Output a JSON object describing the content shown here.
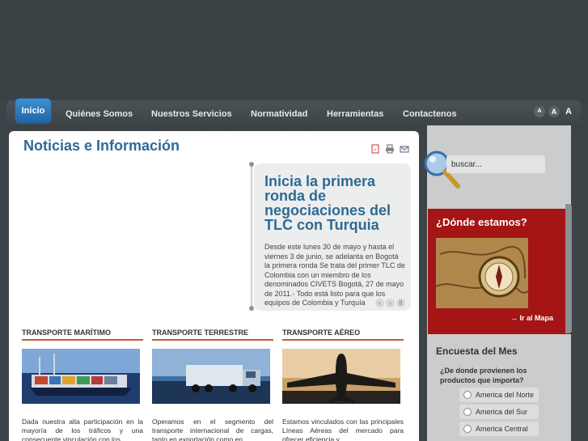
{
  "nav": {
    "items": [
      "Inicio",
      "Quiénes Somos",
      "Nuestros Servicios",
      "Normatividad",
      "Herramientas",
      "Contactenos"
    ],
    "font_sizes": [
      "A",
      "A",
      "A"
    ]
  },
  "main": {
    "title": "Noticias e Información",
    "tools": [
      "pdf-icon",
      "print-icon",
      "email-icon"
    ],
    "slide": {
      "title": "Inicia la primera ronda de negociaciones del TLC con Turquia",
      "text": "Desde este lunes 30 de mayo y hasta el viernes 3 de junio, se adelanta en Bogotá la primera ronda Se trata del primer TLC de Colombia con un miembro de los denominados CIVETS Bogotá, 27 de mayo de 2011.- Todo está listo para que los equipos de Colombia y Turquía",
      "controls": [
        "‹",
        "›",
        "II"
      ]
    },
    "sections": [
      {
        "title": "TRANSPORTE MARÍTIMO",
        "text": "Dada nuestra alta participación en la mayoría de los tráficos y una consecuente vinculación con los"
      },
      {
        "title": "TRANSPORTE TERRESTRE",
        "text": "Operamos en el segmento del transporte internacional de cargas, tanto en exportación como en"
      },
      {
        "title": "TRANSPORTE AÉREO",
        "text": "Estamos vinculados con las principales Líneas Aéreas del mercado para ofrecer eficiencia y"
      }
    ]
  },
  "sidebar": {
    "search": {
      "value": "buscar..."
    },
    "map": {
      "title": "¿Dónde estamos?",
      "link": "→ Ir al Mapa"
    },
    "poll": {
      "title": "Encuesta del Mes",
      "question": "¿De donde provienen los productos que importa?",
      "options": [
        "America del Norte",
        "America del Sur",
        "America Central"
      ]
    }
  },
  "colors": {
    "accent": "#2f6a96",
    "nav_active": "#2a78bd",
    "map_bg": "#a51516",
    "section_rule": "#c85b2e"
  }
}
